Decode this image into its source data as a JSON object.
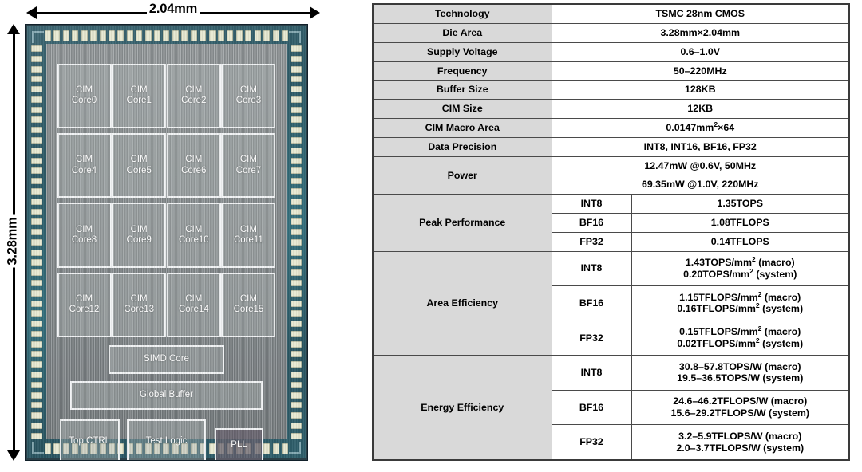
{
  "die_figure": {
    "width_label": "2.04mm",
    "height_label": "3.28mm",
    "blocks": {
      "cim_cores": [
        "CIM\nCore0",
        "CIM\nCore1",
        "CIM\nCore2",
        "CIM\nCore3",
        "CIM\nCore4",
        "CIM\nCore5",
        "CIM\nCore6",
        "CIM\nCore7",
        "CIM\nCore8",
        "CIM\nCore9",
        "CIM\nCore10",
        "CIM\nCore11",
        "CIM\nCore12",
        "CIM\nCore13",
        "CIM\nCore14",
        "CIM\nCore15"
      ],
      "simd_core": "SIMD Core",
      "global_buffer": "Global Buffer",
      "top_ctrl": "Top CTRL",
      "test_logic": "Test Logic",
      "pll": "PLL"
    },
    "colors": {
      "seal_ring": "#2e5b67",
      "core_area": "#8f9597",
      "block_border": "#f2f4f5",
      "pad": "#e8e9d2",
      "pll_fill": "#68626e"
    }
  },
  "spec_table": {
    "colors": {
      "key_cell_bg": "#d9d9d9",
      "value_cell_bg": "#ffffff",
      "border": "#4a4a4a"
    },
    "rows": [
      {
        "key": "Technology",
        "value": "TSMC 28nm CMOS"
      },
      {
        "key": "Die Area",
        "value": "3.28mm×2.04mm"
      },
      {
        "key": "Supply Voltage",
        "value": "0.6–1.0V"
      },
      {
        "key": "Frequency",
        "value": "50–220MHz"
      },
      {
        "key": "Buffer Size",
        "value": "128KB"
      },
      {
        "key": "CIM Size",
        "value": "12KB"
      },
      {
        "key": "CIM Macro Area",
        "value_pre": "0.0147mm",
        "value_sup": "2",
        "value_post": "×64"
      },
      {
        "key": "Data Precision",
        "value": "INT8, INT16, BF16, FP32"
      }
    ],
    "power": {
      "key": "Power",
      "values": [
        "12.47mW @0.6V, 50MHz",
        "69.35mW @1.0V, 220MHz"
      ]
    },
    "peak_performance": {
      "key": "Peak Performance",
      "entries": [
        {
          "precision": "INT8",
          "value": "1.35TOPS"
        },
        {
          "precision": "BF16",
          "value": "1.08TFLOPS"
        },
        {
          "precision": "FP32",
          "value": "0.14TFLOPS"
        }
      ]
    },
    "area_efficiency": {
      "key": "Area Efficiency",
      "entries": [
        {
          "precision": "INT8",
          "macro_pre": "1.43TOPS/mm",
          "macro_sup": "2",
          "macro_post": " (macro)",
          "sys_pre": "0.20TOPS/mm",
          "sys_sup": "2",
          "sys_post": " (system)"
        },
        {
          "precision": "BF16",
          "macro_pre": "1.15TFLOPS/mm",
          "macro_sup": "2",
          "macro_post": " (macro)",
          "sys_pre": "0.16TFLOPS/mm",
          "sys_sup": "2",
          "sys_post": " (system)"
        },
        {
          "precision": "FP32",
          "macro_pre": "0.15TFLOPS/mm",
          "macro_sup": "2",
          "macro_post": " (macro)",
          "sys_pre": "0.02TFLOPS/mm",
          "sys_sup": "2",
          "sys_post": " (system)"
        }
      ]
    },
    "energy_efficiency": {
      "key": "Energy Efficiency",
      "entries": [
        {
          "precision": "INT8",
          "macro": "30.8–57.8TOPS/W (macro)",
          "system": "19.5–36.5TOPS/W (system)"
        },
        {
          "precision": "BF16",
          "macro": "24.6–46.2TFLOPS/W (macro)",
          "system": "15.6–29.2TFLOPS/W (system)"
        },
        {
          "precision": "FP32",
          "macro": "3.2–5.9TFLOPS/W (macro)",
          "system": "2.0–3.7TFLOPS/W (system)"
        }
      ]
    }
  }
}
